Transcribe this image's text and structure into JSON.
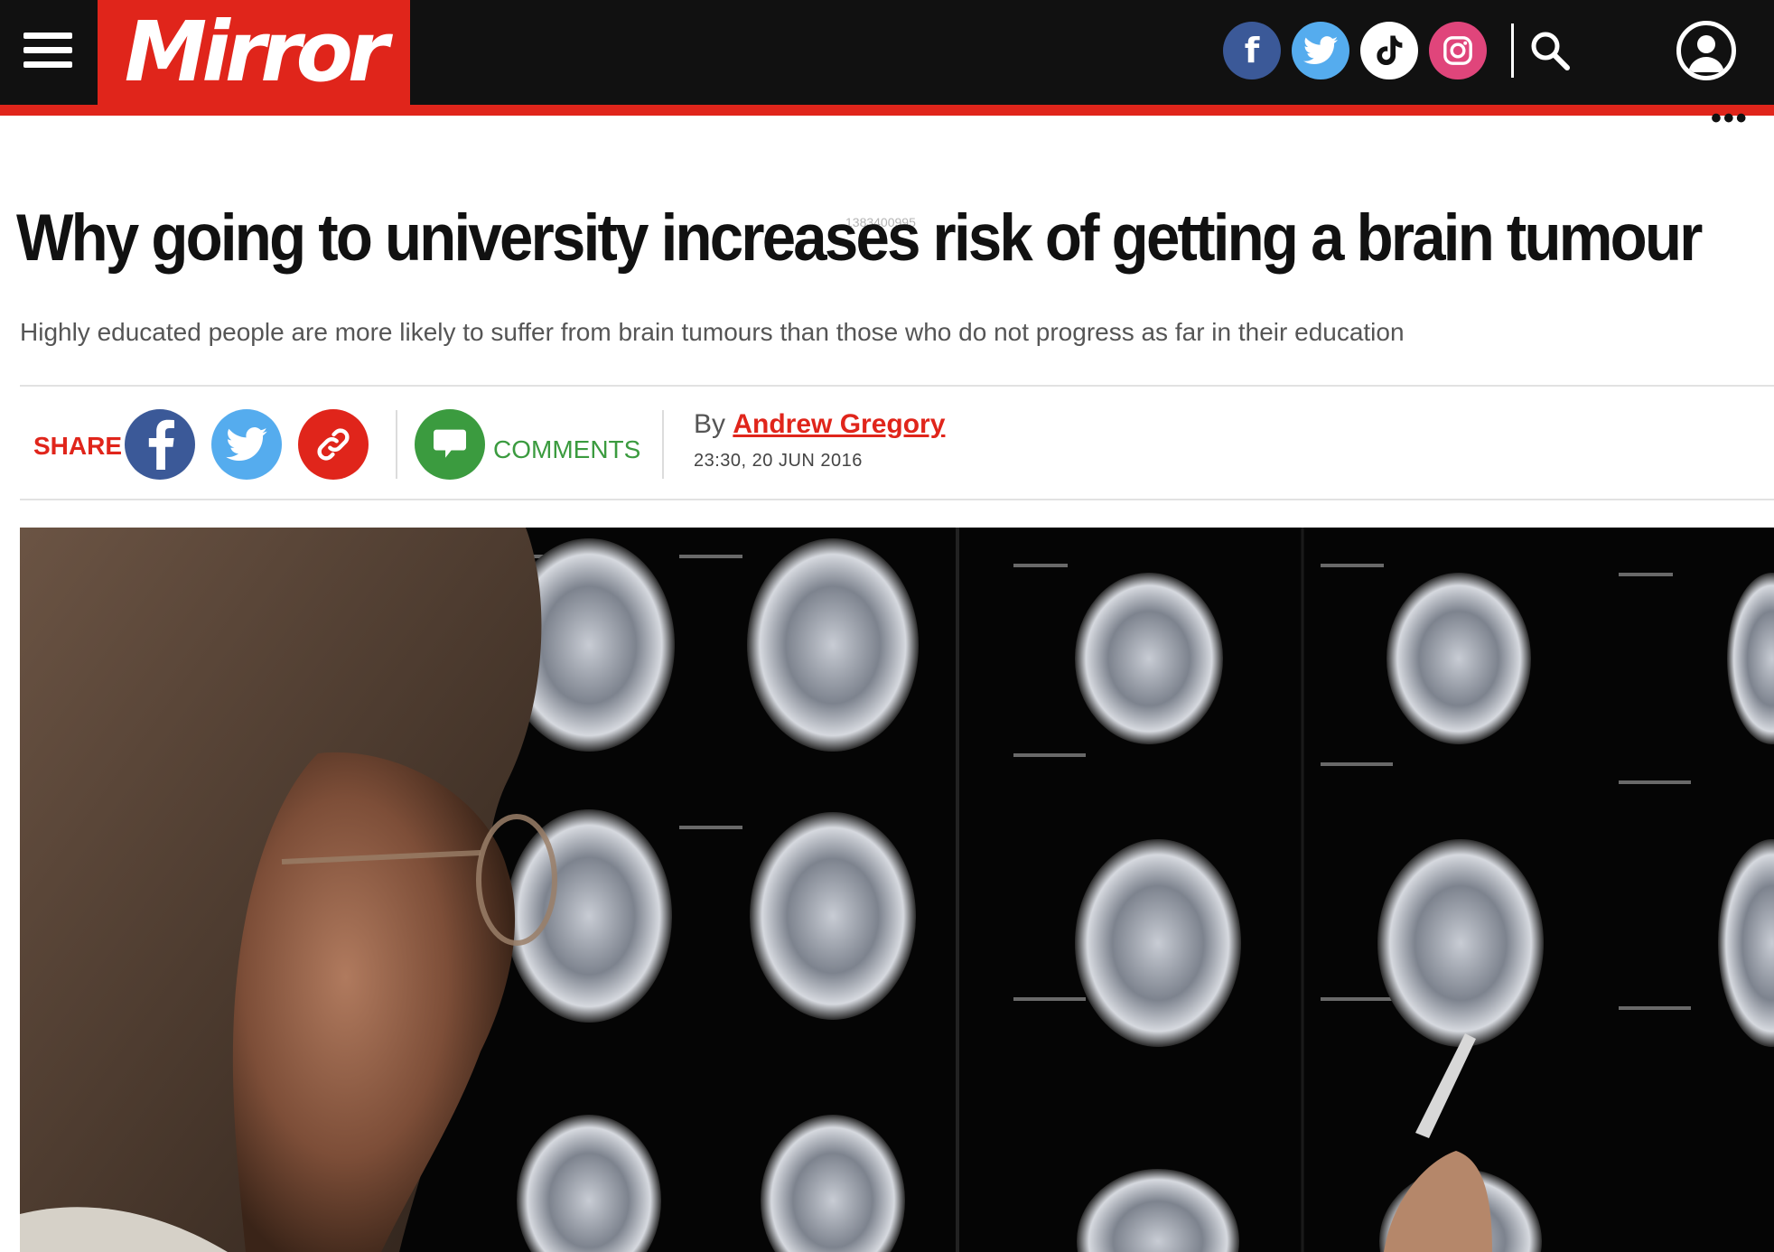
{
  "header": {
    "logo": "Mirror",
    "social": [
      {
        "name": "facebook",
        "icon": "facebook-icon",
        "color": "#3b5998",
        "glyph": "f"
      },
      {
        "name": "twitter",
        "icon": "twitter-icon",
        "color": "#55acee"
      },
      {
        "name": "tiktok",
        "icon": "tiktok-icon",
        "color": "#ffffff"
      },
      {
        "name": "instagram",
        "icon": "instagram-icon",
        "color": "#e0457b"
      }
    ],
    "icons": [
      "menu-icon",
      "search-icon",
      "account-icon",
      "more-icon"
    ],
    "brand_color": "#e0251b"
  },
  "article": {
    "ad_id": "1383400995",
    "headline": "Why going to university increases risk of getting a brain tumour",
    "standfirst": "Highly educated people are more likely to suffer from brain tumours than those who do not progress as far in their education",
    "share_label": "SHARE",
    "comments_label": "COMMENTS",
    "byline_prefix": "By",
    "author": "Andrew Gregory",
    "timestamp": "23:30, 20 JUN 2016",
    "share_buttons": [
      {
        "icon": "facebook-icon",
        "color": "#3b5998",
        "glyph": "f"
      },
      {
        "icon": "twitter-icon",
        "color": "#55acee"
      },
      {
        "icon": "link-icon",
        "color": "#e0251b"
      },
      {
        "icon": "comment-icon",
        "color": "#3b9b3f"
      }
    ]
  }
}
